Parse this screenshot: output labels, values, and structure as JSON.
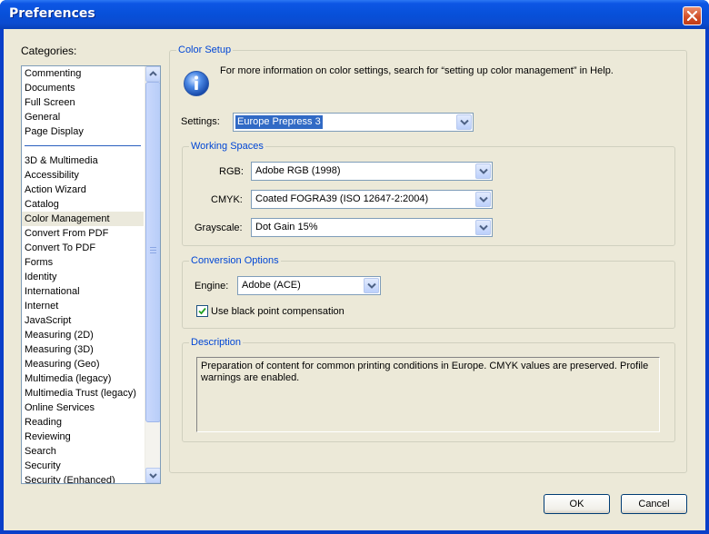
{
  "window": {
    "title": "Preferences"
  },
  "categories": {
    "label": "Categories:",
    "group1": [
      "Commenting",
      "Documents",
      "Full Screen",
      "General",
      "Page Display"
    ],
    "group2": [
      "3D & Multimedia",
      "Accessibility",
      "Action Wizard",
      "Catalog",
      "Color Management",
      "Convert From PDF",
      "Convert To PDF",
      "Forms",
      "Identity",
      "International",
      "Internet",
      "JavaScript",
      "Measuring (2D)",
      "Measuring (3D)",
      "Measuring (Geo)",
      "Multimedia (legacy)",
      "Multimedia Trust (legacy)",
      "Online Services",
      "Reading",
      "Reviewing",
      "Search",
      "Security",
      "Security (Enhanced)"
    ],
    "selected": "Color Management"
  },
  "color_setup": {
    "legend": "Color Setup",
    "info_text": "For more information on color settings, search for “setting up color management” in Help.",
    "settings_label": "Settings:",
    "settings_value": "Europe Prepress 3"
  },
  "working_spaces": {
    "legend": "Working Spaces",
    "rgb_label": "RGB:",
    "rgb_value": "Adobe RGB (1998)",
    "cmyk_label": "CMYK:",
    "cmyk_value": "Coated FOGRA39 (ISO 12647-2:2004)",
    "gray_label": "Grayscale:",
    "gray_value": "Dot Gain 15%"
  },
  "conversion": {
    "legend": "Conversion Options",
    "engine_label": "Engine:",
    "engine_value": "Adobe (ACE)",
    "bpc_label": "Use black point compensation",
    "bpc_checked": true
  },
  "description": {
    "legend": "Description",
    "text": "Preparation of content for common printing conditions in Europe. CMYK values are preserved. Profile warnings are enabled."
  },
  "buttons": {
    "ok": "OK",
    "cancel": "Cancel"
  },
  "colors": {
    "title_bar": "#0750d9",
    "legend_blue": "#0046d5",
    "selection": "#316ac5",
    "dialog_bg": "#ece9d8"
  },
  "icons": {
    "info": "info-icon",
    "close": "close-icon",
    "dropdown": "chevron-down-icon",
    "check": "check-icon"
  }
}
